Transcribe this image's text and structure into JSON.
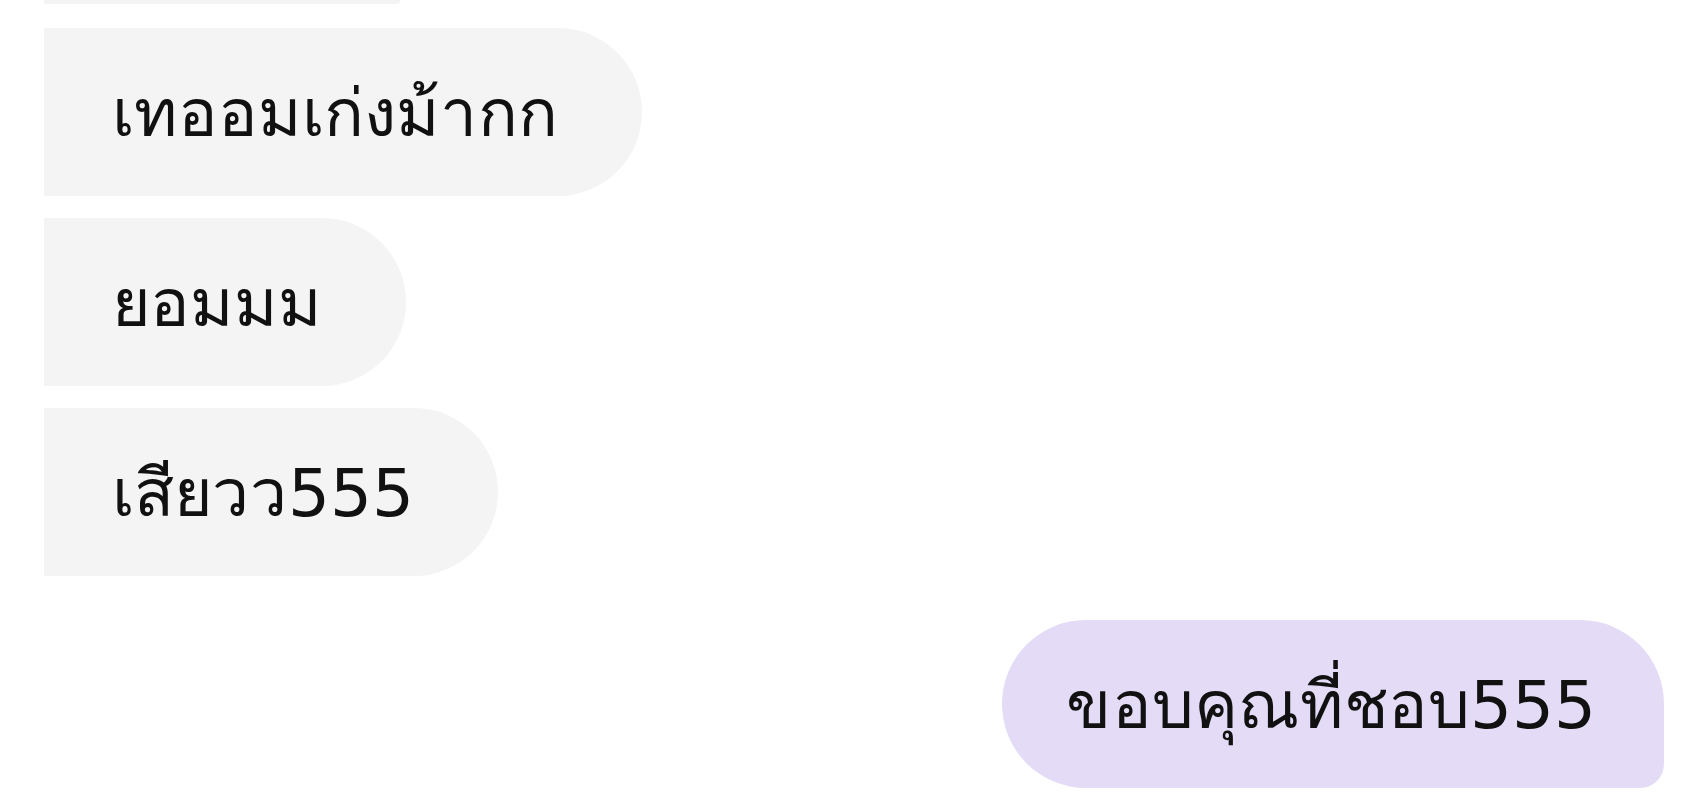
{
  "messages": [
    {
      "kind": "received",
      "text": "เทออมเก่งม้ากก"
    },
    {
      "kind": "received",
      "text": "ยอมมม"
    },
    {
      "kind": "received",
      "text": "เสียวว555"
    },
    {
      "kind": "sent",
      "text": "ขอบคุณที่ชอบ555"
    }
  ]
}
